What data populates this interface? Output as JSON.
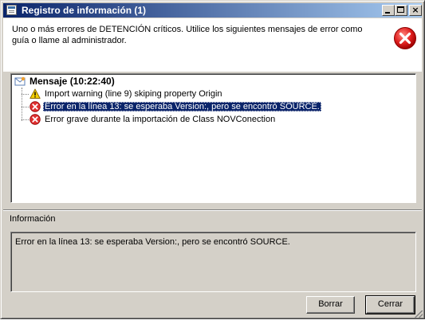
{
  "window": {
    "title": "Registro de información (1)",
    "minimize_glyph": "_",
    "maximize_glyph": "□",
    "close_glyph": "×"
  },
  "header": {
    "message": "Uno o más errores de DETENCIÓN críticos. Utilice los siguientes mensajes de error como guía o llame al administrador.",
    "icon": "error-icon"
  },
  "tree": {
    "root": {
      "label": "Mensaje (10:22:40)",
      "icon": "message-envelope-icon"
    },
    "items": [
      {
        "label": "Import warning (line 9) skiping property Origin",
        "icon": "warning-icon"
      },
      {
        "label": "Error en la línea 13: se esperaba Version:, pero se encontró SOURCE.",
        "icon": "error-icon",
        "selected": true
      },
      {
        "label": "Error grave durante la importación de Class NOVConection",
        "icon": "error-icon"
      }
    ]
  },
  "info": {
    "label": "Información",
    "text": "Error en la línea 13: se esperaba Version:, pero se encontró SOURCE."
  },
  "buttons": {
    "clear": "Borrar",
    "close": "Cerrar"
  },
  "colors": {
    "titlebar_start": "#0a246a",
    "titlebar_end": "#a6caf0",
    "selection": "#0a246a",
    "error_red": "#e03030",
    "warning_yellow": "#f5d000"
  }
}
